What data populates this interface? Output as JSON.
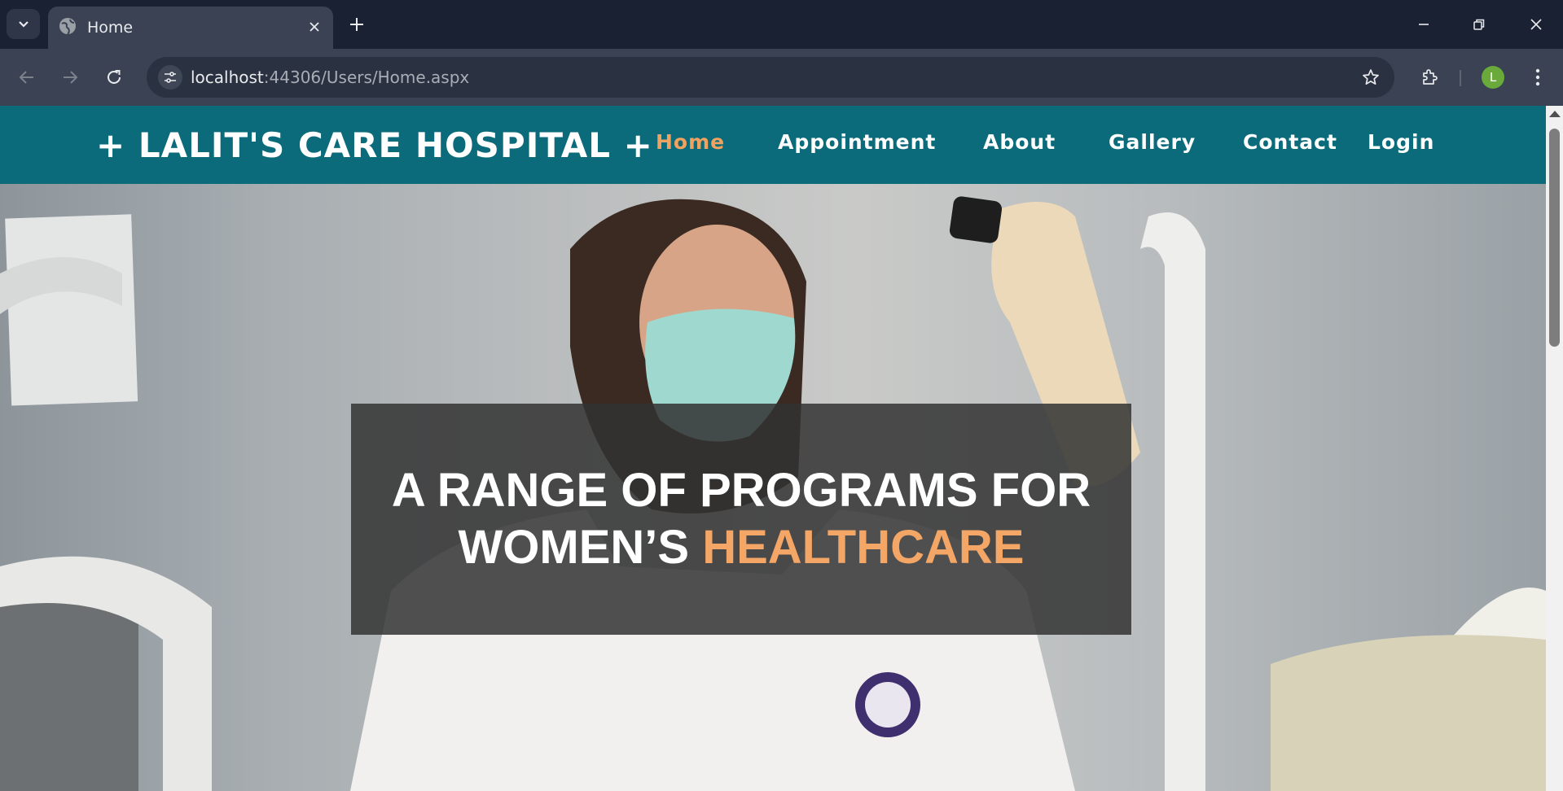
{
  "browser": {
    "tab_title": "Home",
    "url_host": "localhost",
    "url_path": ":44306/Users/Home.aspx",
    "profile_initial": "L"
  },
  "site": {
    "logo": "+ LALIT'S CARE HOSPITAL +",
    "nav": [
      {
        "label": "Home",
        "active": true
      },
      {
        "label": "Appointment",
        "active": false
      },
      {
        "label": "About",
        "active": false
      },
      {
        "label": "Gallery",
        "active": false
      },
      {
        "label": "Contact",
        "active": false
      },
      {
        "label": "Login",
        "active": false
      }
    ],
    "colors": {
      "header": "#0b6b7a",
      "accent": "#f0a260"
    }
  },
  "hero": {
    "headline_line1": "A RANGE OF PROGRAMS FOR",
    "headline_line2_prefix": "WOMEN’S ",
    "headline_line2_accent": "HEALTHCARE"
  }
}
